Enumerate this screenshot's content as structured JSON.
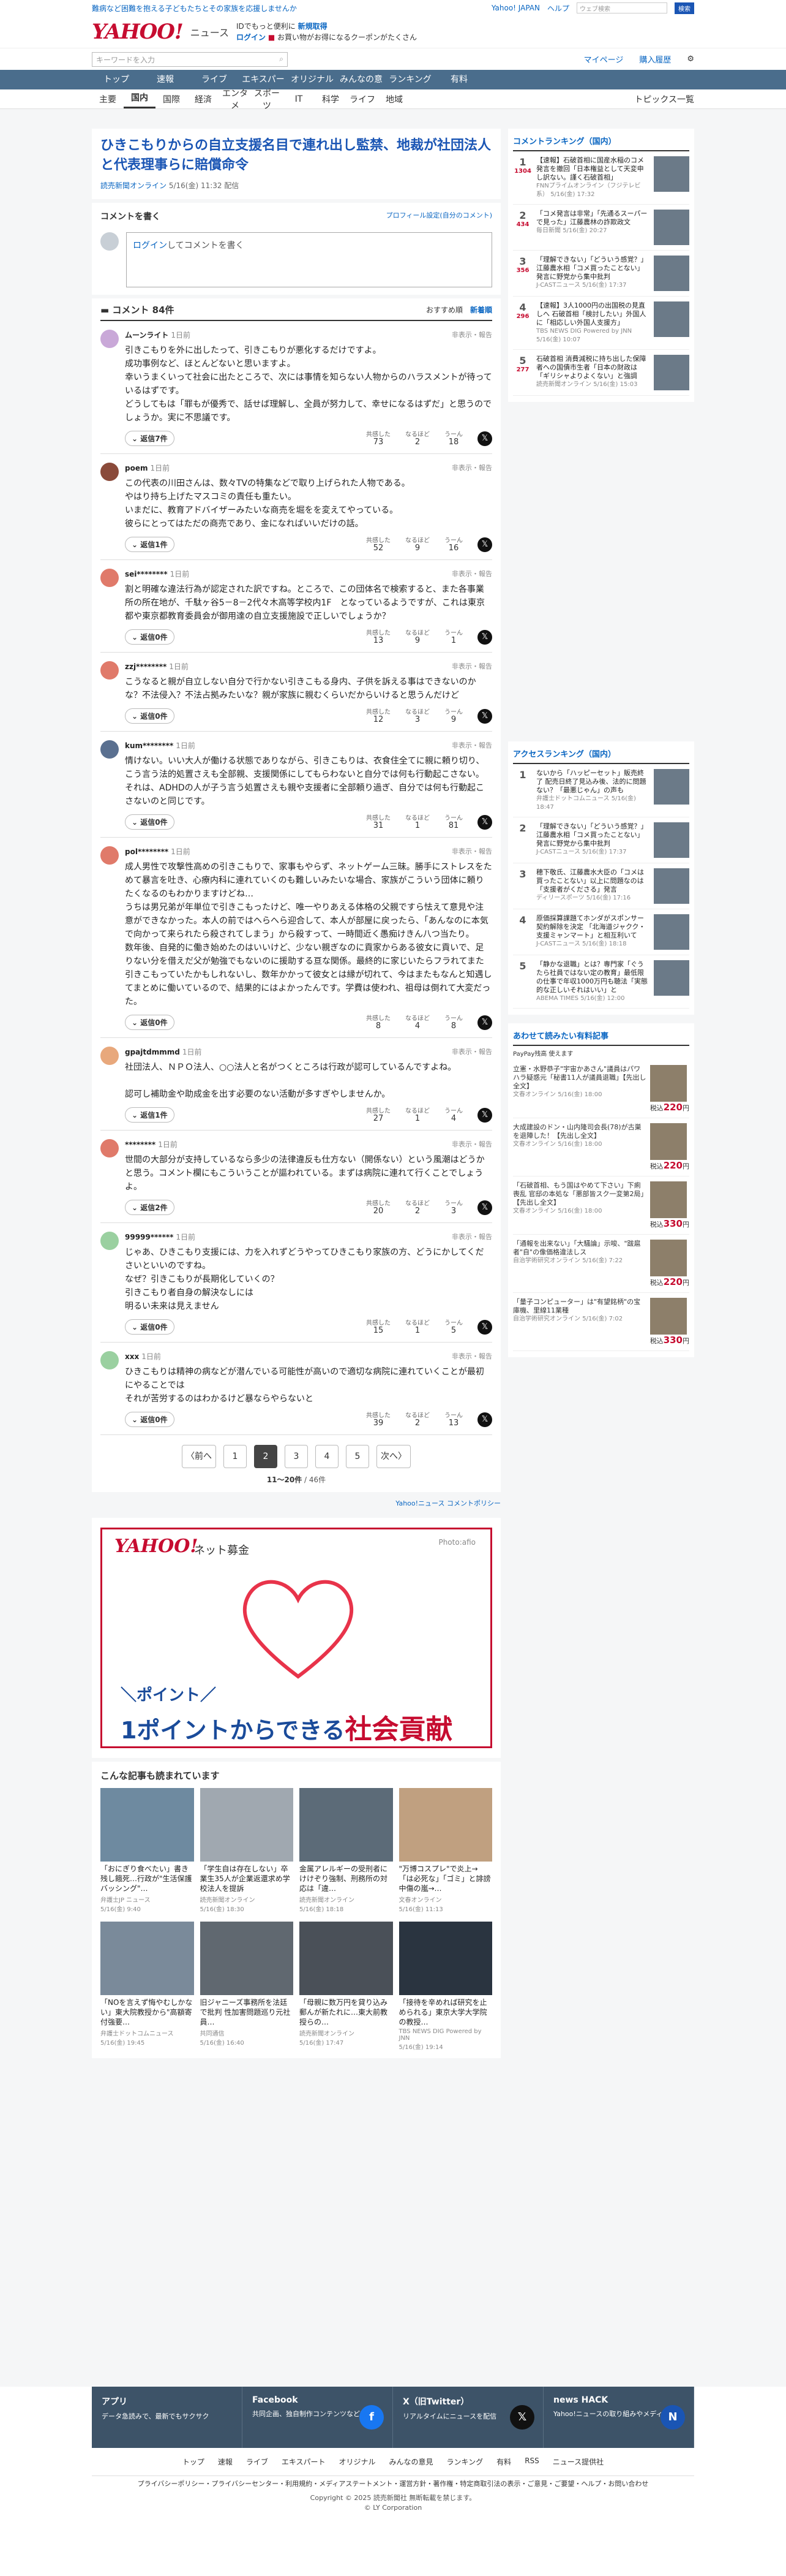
{
  "topbar": {
    "left": "難病など困難を抱える子どもたちとその家族を応援しませんか",
    "links": [
      "Yahoo! JAPAN",
      "ヘルプ"
    ],
    "search_placeholder": "ウェブ検索",
    "search_btn": "検索"
  },
  "header": {
    "logo": "YAHOO!",
    "logo_sub": "ニュース",
    "promo1": "IDでもっと便利に",
    "promo1_link": "新規取得",
    "promo2": "ログイン",
    "promo3": "お買い物がお得になるクーポンがたくさん"
  },
  "search": {
    "placeholder": "キーワードを入力",
    "links": [
      "マイページ",
      "購入履歴"
    ]
  },
  "nav": [
    "トップ",
    "速報",
    "ライブ",
    "エキスパート",
    "オリジナル",
    "みんなの意見",
    "ランキング",
    "有料"
  ],
  "subnav": [
    "主要",
    "国内",
    "国際",
    "経済",
    "エンタメ",
    "スポーツ",
    "IT",
    "科学",
    "ライフ",
    "地域"
  ],
  "subnav_right": "トピックス一覧",
  "article": {
    "title": "ひきこもりからの自立支援名目で連れ出し監禁、地裁が社団法人と代表理事らに賠償命令",
    "source": "読売新聞オンライン",
    "date": "5/16(金) 11:32 配信"
  },
  "comment_box": {
    "title": "コメントを書く",
    "link": "プロフィール設定(自分のコメント)",
    "placeholder_link": "ログイン",
    "placeholder": "してコメントを書く"
  },
  "comments_head": {
    "title": "コメント 84件",
    "sort1": "おすすめ順",
    "sort2": "新着順"
  },
  "comments": [
    {
      "user": "ムーンライト",
      "time": "1日前",
      "txt": "引きこもりを外に出したって、引きこもりが悪化するだけですよ。\n成功事例など、ほとんどないと思いますよ。\n幸いうまくいって社会に出たところで、次には事情を知らない人物からのハラスメントが待っているはずです。\nどうしてもは「罪もが優秀で、話せば理解し、全員が努力して、幸せになるはずだ」と思うのでしょうか。実に不思議です。",
      "replies": "返信7件",
      "a": "73",
      "b": "2",
      "c": "18"
    },
    {
      "user": "poem",
      "time": "1日前",
      "txt": "この代表の川田さんは、数々TVの特集などで取り上げられた人物である。\nやはり持ち上げたマスコミの責任も重たい。\nいまだに、教育アドバイザーみたいな商売を堀をを変えてやっている。\n彼らにとってはただの商売であり、金になればいいだけの話。",
      "replies": "返信1件",
      "a": "52",
      "b": "9",
      "c": "16"
    },
    {
      "user": "sei********",
      "time": "1日前",
      "txt": "割と明確な違法行為が認定された訳ですね。ところで、この団体名で検索すると、また各事業所の所在地が、千駄ヶ谷5－8－2代々木高等学校内1F　となっているようですが、これは東京都や東京都教育委員会が御用達の自立支援施設で正しいでしょうか？",
      "replies": "返信0件",
      "a": "13",
      "b": "9",
      "c": "1"
    },
    {
      "user": "zzj********",
      "time": "1日前",
      "txt": "こうなると親が自立しない自分で行かない引きこもる身内、子供を訴える事はできないのかな？不法侵入？不法占拠みたいな？親が家族に親むくらいだからいけると思うんだけど",
      "replies": "返信0件",
      "a": "12",
      "b": "3",
      "c": "9"
    },
    {
      "user": "kum********",
      "time": "1日前",
      "txt": "情けない。いい大人が働ける状態でありながら、引きこもりは、衣食住全てに親に頼り切り、こう言う法的処置さえも全部親、支援関係にしてもらわないと自分では何も行動起こさない。それは、ADHDの人が子う言う処置さえも親や支援者に全部頼り過ぎ、自分では何も行動起こさないのと同じです。",
      "replies": "返信0件",
      "a": "31",
      "b": "1",
      "c": "81"
    },
    {
      "user": "pol********",
      "time": "1日前",
      "txt": "成人男性で攻撃性高めの引きこもりで、家事もやらず、ネットゲーム三昧。勝手にストレスをためて暴言を吐き、心療内科に連れていくのも難しいみたいな場合、家族がこういう団体に頼りたくなるのもわかりますけどね…\nうちは男兄弟が年単位で引きこもったけど、唯一やりあえる体格の父親ですら怯えて意見や注意ができなかった。本人の前ではヘらへら迎合して、本人が部屋に戻ったら、「あんなのに本気で向かって来られたら殺されてしまう」から殺すって、一時間近く愚痴けきん八つ当たり。\n数年後、自発的に働き始めたのはいいけど、少ない親ぎなのに貢家からある彼女に貢いで、足りない分を借えだ父が勉強でもないのに援助する亘な関係。最終的に家じいたらフラれてまた引きこもっていたかもしれないし、数年かかって彼女とは縁が切れて、今はまたもなんと知遇してまとめに働いているので、結果的にはよかったんです。学費は使われ、祖母は倒れて大変だった。",
      "replies": "返信0件",
      "a": "8",
      "b": "4",
      "c": "8"
    },
    {
      "user": "gpajtdmmmd",
      "time": "1日前",
      "txt": "社団法人、ＮＰＯ法人、○○法人と名がつくところは行政が認可しているんですよね。\n\n認可し補助金や助成金を出す必要のない活動が多すぎやしませんか。",
      "replies": "返信1件",
      "a": "27",
      "b": "1",
      "c": "4"
    },
    {
      "user": "********",
      "time": "1日前",
      "txt": "世間の大部分が支持しているなら多少の法律違反も仕方ない（開係ない）という風潮はどうかと思う。コメント欄にもこういうことが謳われている。まずは病院に連れて行くことでしょうよ。",
      "replies": "返信2件",
      "a": "20",
      "b": "2",
      "c": "3"
    },
    {
      "user": "99999******",
      "time": "1日前",
      "txt": "じゃあ、ひきこもり支援には、力を入れずどうやってひきこもり家族の方、どうにかしてくださいといいのですね。\nなぜ？引きこもりが長期化していくの？\n引きこもり者自身の解決なしには\n明るい未来は見えません",
      "replies": "返信0件",
      "a": "15",
      "b": "1",
      "c": "5"
    },
    {
      "user": "xxx",
      "time": "1日前",
      "txt": "ひきこもりは精神の病などが潜んでいる可能性が高いので適切な病院に連れていくことが最初にやることでは\nそれが苦労するのはわかるけど暴ならやらないと",
      "replies": "返信0件",
      "a": "39",
      "b": "2",
      "c": "13"
    }
  ],
  "react_labels": {
    "a": "共感した",
    "b": "なるほど",
    "c": "うーん",
    "report": "非表示・報告"
  },
  "pager": {
    "prev": "〈前へ",
    "pages": [
      "1",
      "2",
      "3",
      "4",
      "5"
    ],
    "current": "2",
    "next": "次へ〉",
    "count": "11～20件",
    "total": "/ 46件"
  },
  "policy": "Yahoo!ニュース コメントポリシー",
  "ad": {
    "logo": "YAHOO!",
    "logo2": "ネット募金",
    "photo": "Photo:afio",
    "txt1": "＼ポイント／",
    "txt2a": "1ポイントからできる",
    "txt2b": "社会貢献"
  },
  "reco": {
    "title": "こんな記事も読まれています",
    "items": [
      {
        "t": "「おにぎり食べたい」書き残し餓死…行政が\"生活保護バッシング\"…",
        "s": "弁護士JP ニュース",
        "d": "5/16(金) 9:40"
      },
      {
        "t": "「学生自は存在しない」卒業生35人が企業返還求め学校法人を提訴",
        "s": "読売新聞オンライン",
        "d": "5/16(金) 18:30"
      },
      {
        "t": "金属アレルギーの受刑者にけけぞり強制、刑務所の対応は「違…",
        "s": "読売新聞オンライン",
        "d": "5/16(金) 18:18"
      },
      {
        "t": "\"万博コスプレ\"で炎上→「は必死な」「ゴミ」と誹謗中傷の嵐→…",
        "s": "文春オンライン",
        "d": "5/16(金) 11:13"
      },
      {
        "t": "「NOを言えず悔やむしかない」東大院教授から\"高額寄付強要…",
        "s": "弁護士ドットコムニュース",
        "d": "5/16(金) 19:45"
      },
      {
        "t": "旧ジャニーズ事務所を法廷で批判 性加害問題巡り元社員…",
        "s": "共同通信",
        "d": "5/16(金) 16:40"
      },
      {
        "t": "「母親に数万円を貸り込み郵んが新たれに…東大前教授らの…",
        "s": "読売新聞オンライン",
        "d": "5/16(金) 17:47"
      },
      {
        "t": "「接待を辛めれば研究を止められる」東京大学大学院の教授…",
        "s": "TBS NEWS DIG Powered by JNN",
        "d": "5/16(金) 19:14"
      }
    ]
  },
  "side_ranking": {
    "title": "コメントランキング（国内）",
    "items": [
      {
        "n": "1",
        "c": "1304",
        "t": "【速報】石破首相に国産水稲のコメ発言を撤回「日本権益として天変申し訳ない。謹く石破首相」",
        "s": "FNNプライムオンライン（フジテレビ系）",
        "d": "5/16(金) 17:32"
      },
      {
        "n": "2",
        "c": "434",
        "t": "「コメ発言は非常」「先通るスーパーで見った」江藤農林の詐欺政文",
        "s": "毎日新聞",
        "d": "5/16(金) 20:27"
      },
      {
        "n": "3",
        "c": "356",
        "t": "「理解できない」「どういう感覚？」江藤農水相「コメ買ったことない」発言に野党から集中批判",
        "s": "J-CASTニュース",
        "d": "5/16(金) 17:37"
      },
      {
        "n": "4",
        "c": "296",
        "t": "【速報】3人1000円の出国税の見直しへ 石破首相「検討したい」外国人に「相応しい外国人支援方」",
        "s": "TBS NEWS DIG Powered by JNN",
        "d": "5/16(金) 10:07"
      },
      {
        "n": "5",
        "c": "277",
        "t": "石破首相 消費減税に持ち出した保障者への国債市生者「日本の財政は「ギリシャよりよくない」と強調",
        "s": "読売新聞オンライン",
        "d": "5/16(金) 15:03"
      }
    ]
  },
  "side_access": {
    "title": "アクセスランキング（国内）",
    "items": [
      {
        "n": "1",
        "t": "ないから「ハッピーセット」販売終了 配売日終了見込み後、法的に問題ない？「最悪じゃん」の声も",
        "s": "弁護士ドットコムニュース",
        "d": "5/16(金) 18:47"
      },
      {
        "n": "2",
        "t": "「理解できない」「どういう感覚？」江藤農水相「コメ買ったことない」発言に野党から集中批判",
        "s": "J-CASTニュース",
        "d": "5/16(金) 17:37"
      },
      {
        "n": "3",
        "t": "穂下敬氏、江藤農水大臣の「コメは買ったことない」以上に問題なのは「支援者がくださる」発言",
        "s": "ディリースポーツ",
        "d": "5/16(金) 17:16"
      },
      {
        "n": "4",
        "t": "原価採算課題てホンダがスポンサー契約解除を決定 「北海道ジャクク・支援ミャンマート」と相互利いて",
        "s": "J-CASTニュース",
        "d": "5/16(金) 18:18"
      },
      {
        "n": "5",
        "t": "「静かな退職」とは？専門家「ぐうたら社員ではない定の教育」最低限の仕事で年収1000万円も聴法「実態的な正しいそれはいい」と",
        "s": "ABEMA TIMES",
        "d": "5/16(金) 12:00"
      }
    ]
  },
  "side_ads": {
    "title": "あわせて読みたい有料記事",
    "sub": "PayPay残高 使えます",
    "items": [
      {
        "t": "立憲・水野恭子\"宇宙かあさん\"議員はパワハラ疑惑元「秘書11人が議員退職」【先出し全文】",
        "s": "文春オンライン",
        "d": "5/16(金) 18:00",
        "p": "220"
      },
      {
        "t": "大成建設のドン・山内隆司会長(78)が古巣を退陣した！【先出し全文】",
        "s": "文春オンライン",
        "d": "5/16(金) 18:00",
        "p": "220"
      },
      {
        "t": "「石破首相、もう国はやめて下さい」下痢喪乱 官邸の本処な「悪部皆スク一変第2局」【先出し全文】",
        "s": "文春オンライン",
        "d": "5/16(金) 18:00",
        "p": "330"
      },
      {
        "t": "「通報を出来ない」「大騒論」示唆、\"跋扈者\"自\"の像価格違法しス",
        "s": "自治学術研究オンライン",
        "d": "5/16(金) 7:22",
        "p": "220"
      },
      {
        "t": "「量子コンピューター」は\"有望銘柄\"の宝庫機、里線11業種",
        "s": "自治学術研究オンライン",
        "d": "5/16(金) 7:02",
        "p": "330"
      }
    ]
  },
  "footer": {
    "blocks": [
      {
        "t": "アプリ",
        "d": "データ急読みで、最新でもサクサク"
      },
      {
        "t": "Facebook",
        "d": "共同企画、独自制作コンテンツなどを発信"
      },
      {
        "t": "X（旧Twitter）",
        "d": "リアルタイムにニュースを配信"
      },
      {
        "t": "news HACK",
        "d": "Yahoo!ニュースの取り組みやメディア"
      }
    ],
    "nav": [
      "トップ",
      "速報",
      "ライブ",
      "エキスパート",
      "オリジナル",
      "みんなの意見",
      "ランキング",
      "有料",
      "RSS",
      "ニュース提供社"
    ],
    "links": "プライバシーポリシー・プライバシーセンター・利用規約・メディアステートメント・運営方針・著作権・特定商取引法の表示・ご意見・ご要望・ヘルプ・お問い合わせ",
    "copy1": "Copyright © 2025 読売新聞社 無断転載を禁じます。",
    "copy2": "© LY Corporation"
  },
  "colors": {
    "nav": "#4a6d8c",
    "accent": "#0a66c2",
    "brand": "#c60c30"
  }
}
